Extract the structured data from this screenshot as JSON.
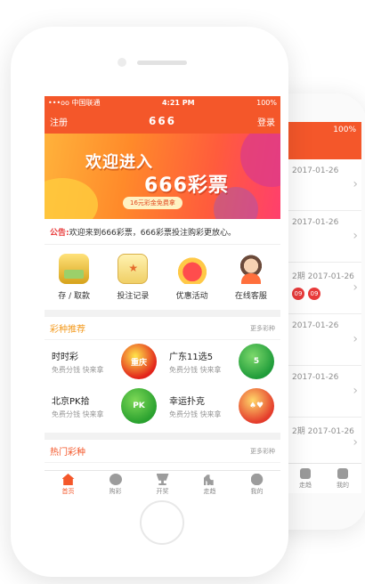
{
  "back_screen": {
    "status_battery": "100%",
    "rows": [
      {
        "date": "2017-01-26"
      },
      {
        "date": "2017-01-26"
      },
      {
        "date": "2期 2017-01-26",
        "balls": [
          "09",
          "09"
        ]
      },
      {
        "date": "2017-01-26"
      },
      {
        "date": "2017-01-26"
      },
      {
        "date": "2期 2017-01-26"
      }
    ],
    "tabs": [
      {
        "label": "走趋"
      },
      {
        "label": "我的"
      }
    ]
  },
  "status_bar": {
    "carrier": "•••oo 中国联通",
    "time": "4:21 PM",
    "battery": "100%"
  },
  "nav": {
    "left": "注册",
    "title": "666",
    "right": "登录"
  },
  "banner": {
    "line1": "欢迎进入",
    "line2": "666彩票",
    "pill": "16元彩金免费拿"
  },
  "notice": {
    "label": "公告:",
    "text": "欢迎来到666彩票，666彩票投注购彩更放心。"
  },
  "quick_links": [
    {
      "label": "存 / 取款",
      "icon": "money-stack-icon"
    },
    {
      "label": "投注记录",
      "icon": "record-book-icon"
    },
    {
      "label": "优惠活动",
      "icon": "gift-box-icon"
    },
    {
      "label": "在线客服",
      "icon": "customer-service-icon"
    }
  ],
  "recommend": {
    "title": "彩种推荐",
    "more": "更多彩种",
    "items": [
      {
        "name": "时时彩",
        "sub": "免费分钱  快来拿",
        "logo_text": "重庆"
      },
      {
        "name": "广东11选5",
        "sub": "免费分钱  快来拿",
        "logo_text": "5"
      },
      {
        "name": "北京PK拾",
        "sub": "免费分钱  快来拿",
        "logo_text": "PK"
      },
      {
        "name": "幸运扑克",
        "sub": "免费分钱  快来拿",
        "logo_text": "♠♥"
      }
    ]
  },
  "hot": {
    "title": "热门彩种",
    "more": "更多彩种"
  },
  "tabbar": [
    {
      "label": "首页",
      "icon": "home-icon"
    },
    {
      "label": "购彩",
      "icon": "wheel-icon"
    },
    {
      "label": "开奖",
      "icon": "trophy-icon"
    },
    {
      "label": "走趋",
      "icon": "bar-chart-icon"
    },
    {
      "label": "我的",
      "icon": "user-icon"
    }
  ],
  "colors": {
    "brand": "#f4572a",
    "accent_orange": "#f39a1e",
    "notice_red": "#e83a3a"
  }
}
